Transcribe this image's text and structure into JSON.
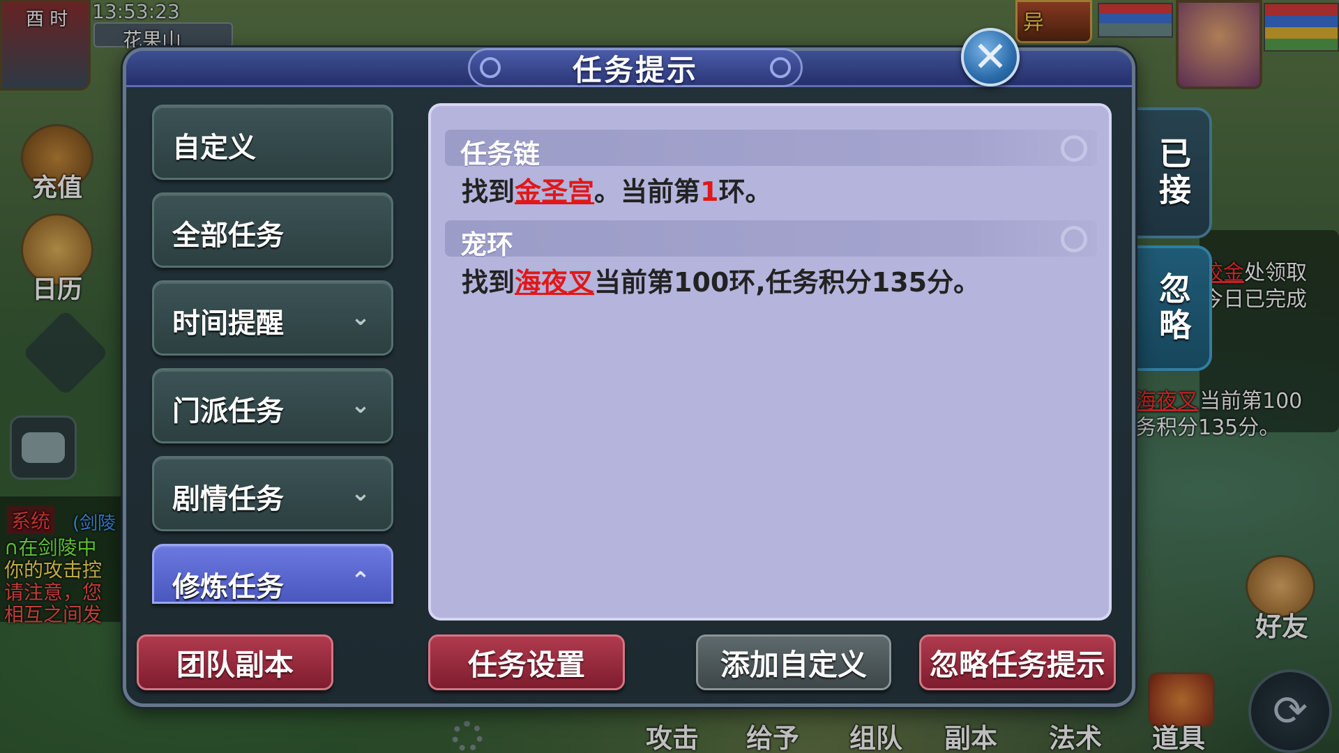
{
  "hud": {
    "clock_labels": "酉 时",
    "time": "13:53:23",
    "location": "花果山",
    "recharge": "充值",
    "calendar": "日历",
    "friends": "好友",
    "items": "道具",
    "bottom_skills": [
      "攻击",
      "给予",
      "组队",
      "副本",
      "法术"
    ],
    "chat_channel": "系统",
    "chat_lines": [
      "(剑陵",
      "∩在剑陵中",
      "你的攻击控",
      "请注意，您",
      "相互之间发"
    ],
    "bg_task_1a": "校金",
    "bg_task_1b": "处领取",
    "bg_task_1c": "今日已完成",
    "bg_task_2a": "海夜叉",
    "bg_task_2b": "当前第100",
    "bg_task_2c": "务积分135分。",
    "buff_label": "异"
  },
  "dialog": {
    "title": "任务提示",
    "close_symbol": "✕"
  },
  "sidebar": {
    "items": [
      {
        "label": "自定义",
        "chevron": ""
      },
      {
        "label": "全部任务",
        "chevron": ""
      },
      {
        "label": "时间提醒",
        "chevron": "⌄"
      },
      {
        "label": "门派任务",
        "chevron": "⌄"
      },
      {
        "label": "剧情任务",
        "chevron": "⌄"
      },
      {
        "label": "修炼任务",
        "chevron": "⌃"
      }
    ]
  },
  "tasks": [
    {
      "header": "任务链",
      "prefix": "找到",
      "link": "金圣宫",
      "middle": "。当前第",
      "number": "1",
      "suffix": "环。"
    },
    {
      "header": "宠环",
      "prefix": "找到",
      "link": "海夜叉",
      "middle": "当前第100环,任务积分135分。",
      "number": "",
      "suffix": ""
    }
  ],
  "side_tabs": {
    "accepted": "已接",
    "ignored": "忽略"
  },
  "actions": {
    "team_dungeon": "团队副本",
    "task_settings": "任务设置",
    "add_custom": "添加自定义",
    "ignore_hints": "忽略任务提示"
  }
}
